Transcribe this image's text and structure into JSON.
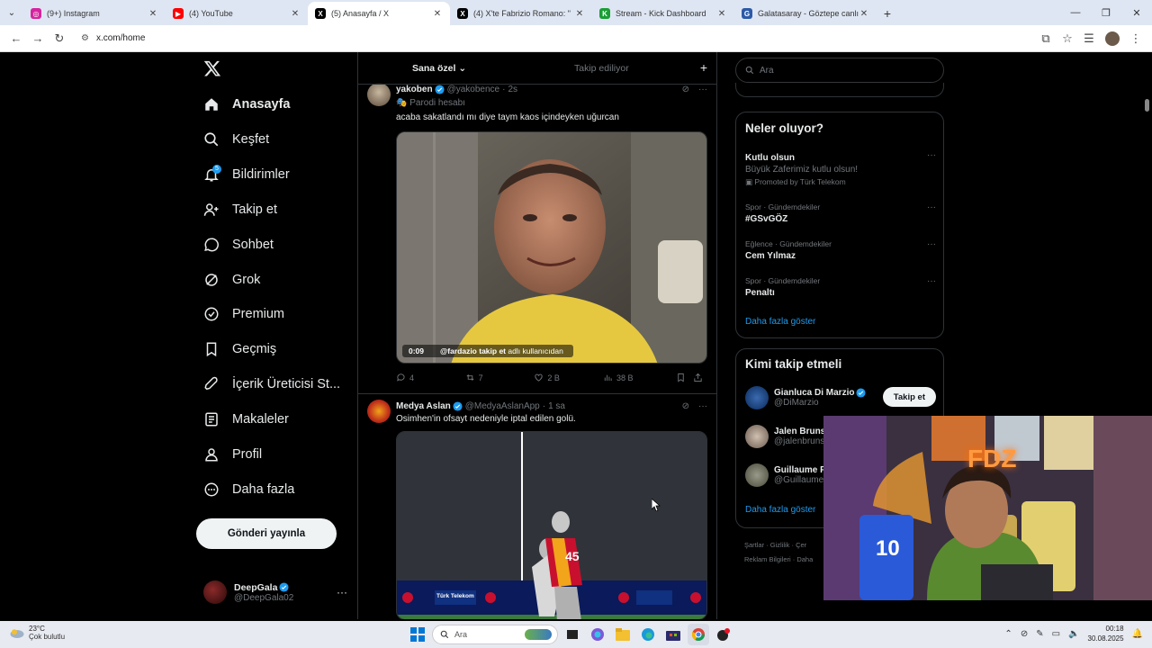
{
  "browser": {
    "tabs": [
      {
        "title": "(9+) Instagram",
        "color": "#d6249f",
        "letter": "◎",
        "active": false
      },
      {
        "title": "(4) YouTube",
        "color": "#ff0000",
        "letter": "▶",
        "active": false
      },
      {
        "title": "(5) Anasayfa / X",
        "color": "#000000",
        "letter": "X",
        "active": true
      },
      {
        "title": "(4) X'te Fabrizio Romano: \"",
        "color": "#000000",
        "letter": "X",
        "active": false
      },
      {
        "title": "Stream - Kick Dashboard",
        "color": "#1a9e35",
        "letter": "K",
        "active": false
      },
      {
        "title": "Galatasaray - Göztepe canlı skor",
        "color": "#2c5aa8",
        "letter": "G",
        "active": false
      }
    ],
    "url": "x.com/home"
  },
  "nav": {
    "items": [
      {
        "label": "Anasayfa",
        "icon": "home-icon",
        "active": true
      },
      {
        "label": "Keşfet",
        "icon": "search-icon"
      },
      {
        "label": "Bildirimler",
        "icon": "bell-icon",
        "badge": "5"
      },
      {
        "label": "Takip et",
        "icon": "follow-icon"
      },
      {
        "label": "Sohbet",
        "icon": "chat-icon"
      },
      {
        "label": "Grok",
        "icon": "grok-icon"
      },
      {
        "label": "Premium",
        "icon": "premium-icon"
      },
      {
        "label": "Geçmiş",
        "icon": "bookmark-icon"
      },
      {
        "label": "İçerik Üreticisi St...",
        "icon": "rocket-icon"
      },
      {
        "label": "Makaleler",
        "icon": "article-icon"
      },
      {
        "label": "Profil",
        "icon": "profile-icon"
      },
      {
        "label": "Daha fazla",
        "icon": "more-circle-icon"
      }
    ],
    "post_button": "Gönderi yayınla",
    "account": {
      "name": "DeepGala",
      "handle": "@DeepGala02"
    }
  },
  "feed": {
    "tabs": {
      "for_you": "Sana özel",
      "following": "Takip ediliyor"
    },
    "tweets": [
      {
        "name": "yakoben",
        "handle": "@yakobence",
        "time": "2s",
        "sub": "Parodi hesabı",
        "text": "acaba sakatlandı mı diye taym kaos içindeyken uğurcan",
        "video_time": "0:09",
        "video_caption_bold": "@fardazio takip et",
        "video_caption": "adlı kullanıcıdan",
        "replies": "4",
        "reposts": "7",
        "likes": "2 B",
        "views": "38 B"
      },
      {
        "name": "Medya Aslan",
        "handle": "@MedyaAslanApp",
        "time": "1 sa",
        "text": "Osimhen'in ofsayt nedeniyle iptal edilen golü.",
        "jersey_number": "45",
        "board_text": "Türk Telekom"
      }
    ]
  },
  "right": {
    "search_placeholder": "Ara",
    "trends_title": "Neler oluyor?",
    "trends": [
      {
        "category": "",
        "title": "Kutlu olsun",
        "subtitle": "Büyük Zaferimiz kutlu olsun!",
        "promoted": "Promoted by Türk Telekom"
      },
      {
        "category": "Spor · Gündemdekiler",
        "title": "#GSvGÖZ"
      },
      {
        "category": "Eğlence · Gündemdekiler",
        "title": "Cem Yılmaz"
      },
      {
        "category": "Spor · Gündemdekiler",
        "title": "Penaltı"
      }
    ],
    "show_more": "Daha fazla göster",
    "who_title": "Kimi takip etmeli",
    "who": [
      {
        "name": "Gianluca Di Marzio",
        "handle": "@DiMarzio",
        "verified": true
      },
      {
        "name": "Jalen Bruns",
        "handle": "@jalenbruns"
      },
      {
        "name": "Guillaume F",
        "handle": "@Guillaume"
      }
    ],
    "follow_label": "Takip et",
    "footer_line1": "Şartlar  ·  Gizlilik  ·  Çer",
    "footer_line2": "Reklam Bilgileri  ·  Daha"
  },
  "taskbar": {
    "temp": "23°C",
    "weather": "Çok bulutlu",
    "search": "Ara",
    "time": "00:18",
    "date": "30.08.2025"
  },
  "webcam": {
    "neon_text": "FDZ",
    "jersey_number": "10"
  }
}
